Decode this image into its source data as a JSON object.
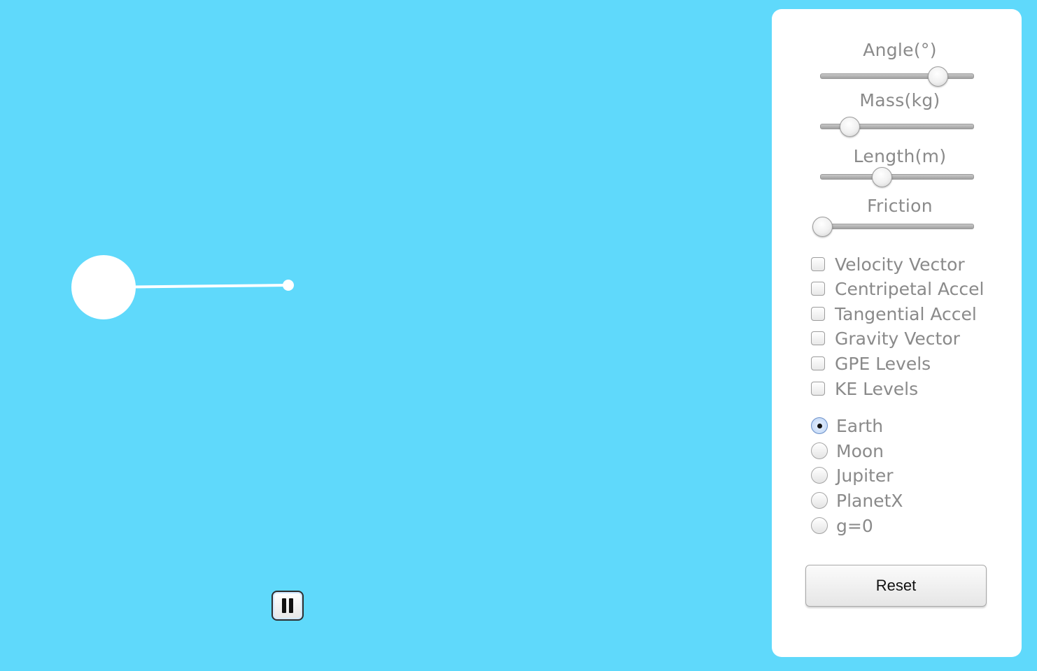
{
  "colors": {
    "background": "#5fd9fb",
    "panel": "#ffffff",
    "pendulum": "#ffffff",
    "label_text": "#8a8a8a",
    "radio_selected": "#b9d2f4"
  },
  "simulation": {
    "pause_button_icon": "pause-icon"
  },
  "controls": {
    "sliders": [
      {
        "label": "Angle(°)",
        "position": 0.76
      },
      {
        "label": "Mass(kg)",
        "position": 0.18
      },
      {
        "label": "Length(m)",
        "position": 0.39
      },
      {
        "label": "Friction",
        "position": 0.0
      }
    ],
    "checkboxes": [
      {
        "label": "Velocity Vector",
        "checked": false
      },
      {
        "label": "Centripetal Accel",
        "checked": false
      },
      {
        "label": "Tangential Accel",
        "checked": false
      },
      {
        "label": "Gravity Vector",
        "checked": false
      },
      {
        "label": "GPE Levels",
        "checked": false
      },
      {
        "label": "KE Levels",
        "checked": false
      }
    ],
    "gravity_options": [
      {
        "label": "Earth",
        "selected": true
      },
      {
        "label": "Moon",
        "selected": false
      },
      {
        "label": "Jupiter",
        "selected": false
      },
      {
        "label": "PlanetX",
        "selected": false
      },
      {
        "label": "g=0",
        "selected": false
      }
    ],
    "reset_label": "Reset"
  }
}
